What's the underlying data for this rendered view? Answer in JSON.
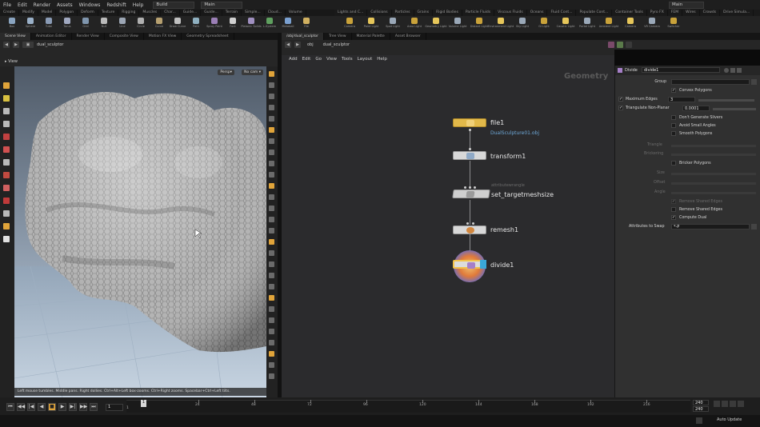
{
  "menubar": {
    "items": [
      "File",
      "Edit",
      "Render",
      "Assets",
      "Windows",
      "Redshift",
      "Help"
    ],
    "desktop": "Build",
    "context": "Main",
    "right_desktop": "Main"
  },
  "shelf": {
    "left_tabs": [
      "Create",
      "Modify",
      "Model",
      "Polygon",
      "Deform",
      "Texture",
      "Rigging",
      "Muscles",
      "Char...",
      "Guide...",
      "Guide...",
      "Terrain",
      "Simple...",
      "Cloud...",
      "Volume"
    ],
    "left_tools": [
      "Box",
      "Sphere",
      "Tube",
      "Torus",
      "Grid",
      "Null",
      "Line",
      "Circle",
      "Curve",
      "Draw Curve",
      "Path",
      "Spray Paint",
      "Font",
      "Platonic Solids",
      "L-System",
      "Metaball",
      "File"
    ],
    "right_tabs": [
      "Lights and C...",
      "Collisions",
      "Particles",
      "Grains",
      "Rigid Bodies",
      "Particle Fluids",
      "Viscous Fluids",
      "Oceans",
      "Fluid Cont...",
      "Populate Cont...",
      "Container Tools",
      "Pyro FX",
      "FEM",
      "Wires",
      "Crowds",
      "Drive Simula..."
    ],
    "right_tools": [
      "Camera",
      "Point Light",
      "Spot Light",
      "Area Light",
      "Geometry Light",
      "Volume Light",
      "Distant Light",
      "Environment Light",
      "Sky Light",
      "GI Light",
      "Caustic Light",
      "Portal Light",
      "Ambient Light",
      "Camera",
      "VR Camera",
      "Switcher"
    ]
  },
  "left_pane": {
    "tabs": [
      "Scene View",
      "Animation Editor",
      "Render View",
      "Composite View",
      "Motion FX View",
      "Geometry Spreadsheet"
    ],
    "path": "dual_sculptor",
    "view_label": "View",
    "persp_btn": "Persp▾",
    "cam_btn": "No cam ▾",
    "status": "Left mouse tumbles. Middle pans. Right dollies. Ctrl+Alt+Left box-zooms. Ctrl+Right zooms. Spacebar+Ctrl+Left tilts."
  },
  "right_pane": {
    "tabs": [
      "/obj/dual_sculptor",
      "Tree View",
      "Material Palette",
      "Asset Browser"
    ],
    "obj": "obj",
    "path": "dual_sculptor",
    "menu": [
      "Add",
      "Edit",
      "Go",
      "View",
      "Tools",
      "Layout",
      "Help"
    ],
    "title": "Geometry",
    "nodes": [
      {
        "name": "file1",
        "sub": "DualSculpture01.obj",
        "color": "#e2b94a"
      },
      {
        "name": "transform1",
        "sub": "",
        "color": "#8fa9c6"
      },
      {
        "name": "set_targetmeshsize",
        "sub": "attributewrangle",
        "color": "#9a9a9a"
      },
      {
        "name": "remesh1",
        "sub": "",
        "color": "#d2873f"
      },
      {
        "name": "divide1",
        "sub": "",
        "color": "#a67fc8"
      }
    ]
  },
  "params": {
    "type_label": "Divide",
    "node_name": "divide1",
    "group_label": "Group",
    "convex_polygons": "Convex Polygons",
    "max_edges_label": "Maximum Edges",
    "max_edges_value": "3",
    "triangulate_label": "Triangulate Non-Planar",
    "triangulate_value": "0.0001",
    "dont_generate": "Don't Generate Slivers",
    "avoid_small": "Avoid Small Angles",
    "smooth_polygons": "Smooth Polygons",
    "bricker_polygons": "Bricker Polygons",
    "size_label": "Size",
    "offset_label": "Offset",
    "angle_label": "Angle",
    "remove_shared": "Remove Shared Edges",
    "compute_dual": "Compute Dual",
    "attributes_label": "Attributes to Swap",
    "attributes_value": "*-P",
    "dim_labels": [
      "Triangle",
      "Brickering"
    ]
  },
  "timeline": {
    "frame": "1",
    "start": "1",
    "end": "240",
    "end2": "240",
    "ticks": [
      "24",
      "48",
      "72",
      "96",
      "120",
      "144",
      "168",
      "192",
      "216"
    ],
    "auto_update": "Auto Update"
  },
  "colors": {
    "network_bg": "#2b2b2d",
    "param_bg": "#303030",
    "accent_orange": "#e0a43a"
  }
}
